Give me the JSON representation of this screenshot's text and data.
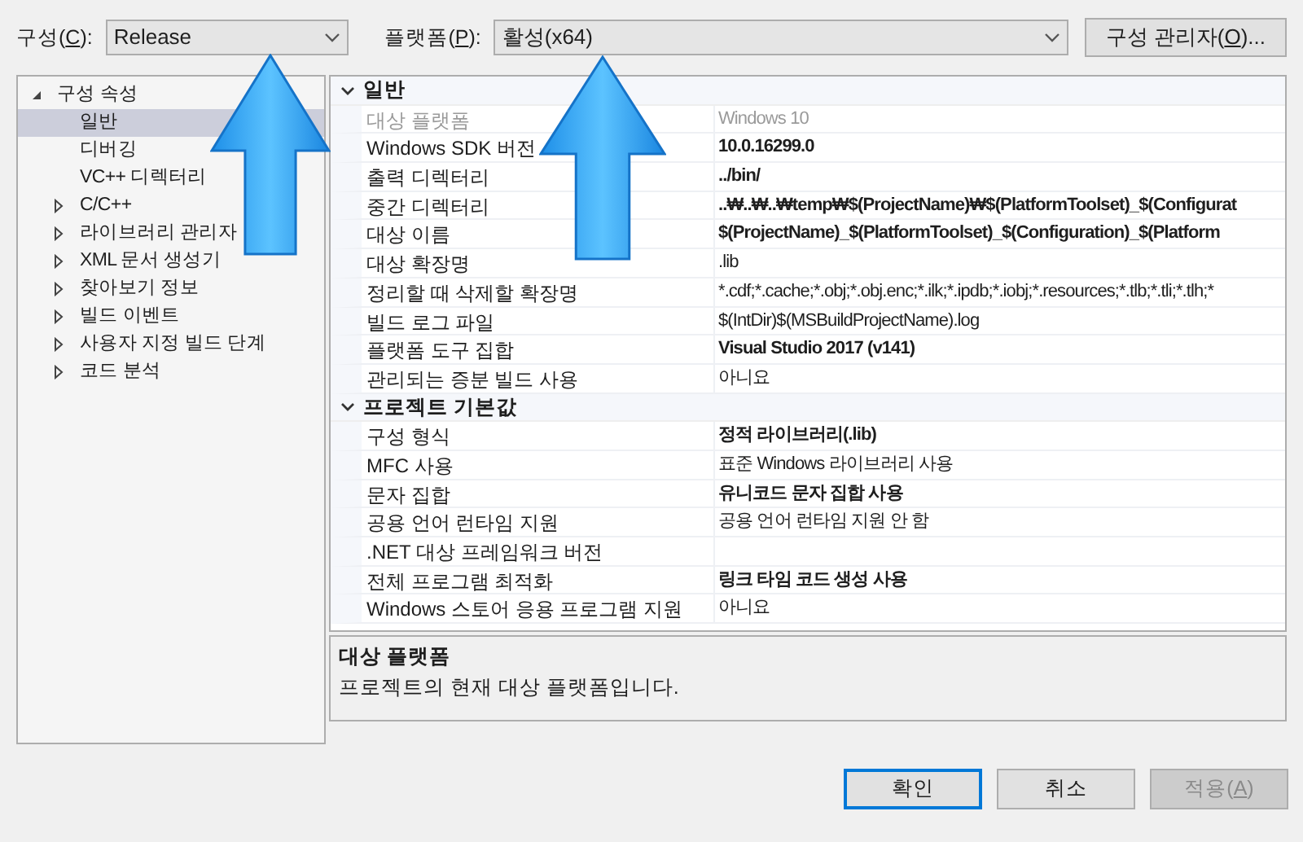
{
  "config": {
    "label": {
      "before": "구성(",
      "key": "C",
      "after": "):"
    },
    "value": "Release"
  },
  "platform": {
    "label": {
      "before": "플랫폼(",
      "key": "P",
      "after": "):"
    },
    "value": "활성(x64)"
  },
  "config_manager": {
    "label": {
      "before": "구성 관리자(",
      "key": "O",
      "after": ")..."
    }
  },
  "tree": [
    {
      "label": "구성 속성",
      "kind": "group",
      "expanded": true,
      "selected": false,
      "children": [
        {
          "label": "일반",
          "kind": "page",
          "selected": true
        },
        {
          "label": "디버깅",
          "kind": "page",
          "selected": false
        },
        {
          "label": "VC++ 디렉터리",
          "kind": "page",
          "selected": false
        },
        {
          "label": "C/C++",
          "kind": "group",
          "expanded": false,
          "selected": false
        },
        {
          "label": "라이브러리 관리자",
          "kind": "group",
          "expanded": false,
          "selected": false
        },
        {
          "label": "XML 문서 생성기",
          "kind": "group",
          "expanded": false,
          "selected": false
        },
        {
          "label": "찾아보기 정보",
          "kind": "group",
          "expanded": false,
          "selected": false
        },
        {
          "label": "빌드 이벤트",
          "kind": "group",
          "expanded": false,
          "selected": false
        },
        {
          "label": "사용자 지정 빌드 단계",
          "kind": "group",
          "expanded": false,
          "selected": false
        },
        {
          "label": "코드 분석",
          "kind": "group",
          "expanded": false,
          "selected": false
        }
      ]
    }
  ],
  "sections": [
    {
      "title": "일반",
      "expanded": true,
      "rows": [
        {
          "name": "대상 플랫폼",
          "value": "Windows 10",
          "bold": false,
          "disabled": true
        },
        {
          "name": "Windows SDK 버전",
          "value": "10.0.16299.0",
          "bold": true,
          "disabled": false
        },
        {
          "name": "출력 디렉터리",
          "value": "../bin/",
          "bold": true,
          "disabled": false
        },
        {
          "name": "중간 디렉터리",
          "value": "..₩..₩..₩temp₩$(ProjectName)₩$(PlatformToolset)_$(Configurat",
          "bold": true,
          "disabled": false
        },
        {
          "name": "대상 이름",
          "value": "$(ProjectName)_$(PlatformToolset)_$(Configuration)_$(Platform",
          "bold": true,
          "disabled": false
        },
        {
          "name": "대상 확장명",
          "value": ".lib",
          "bold": false,
          "disabled": false
        },
        {
          "name": "정리할 때 삭제할 확장명",
          "value": "*.cdf;*.cache;*.obj;*.obj.enc;*.ilk;*.ipdb;*.iobj;*.resources;*.tlb;*.tli;*.tlh;*",
          "bold": false,
          "disabled": false
        },
        {
          "name": "빌드 로그 파일",
          "value": "$(IntDir)$(MSBuildProjectName).log",
          "bold": false,
          "disabled": false
        },
        {
          "name": "플랫폼 도구 집합",
          "value": "Visual Studio 2017 (v141)",
          "bold": true,
          "disabled": false
        },
        {
          "name": "관리되는 증분 빌드 사용",
          "value": "아니요",
          "bold": false,
          "disabled": false
        }
      ]
    },
    {
      "title": "프로젝트 기본값",
      "expanded": true,
      "rows": [
        {
          "name": "구성 형식",
          "value": "정적 라이브러리(.lib)",
          "bold": true,
          "disabled": false
        },
        {
          "name": "MFC 사용",
          "value": "표준 Windows 라이브러리 사용",
          "bold": false,
          "disabled": false
        },
        {
          "name": "문자 집합",
          "value": "유니코드 문자 집합 사용",
          "bold": true,
          "disabled": false
        },
        {
          "name": "공용 언어 런타임 지원",
          "value": "공용 언어 런타임 지원 안 함",
          "bold": false,
          "disabled": false
        },
        {
          "name": ".NET 대상 프레임워크 버전",
          "disabled": false
        },
        {
          "name": "전체 프로그램 최적화",
          "value": "링크 타임 코드 생성 사용",
          "bold": true,
          "disabled": false
        },
        {
          "name": "Windows 스토어 응용 프로그램 지원",
          "value": "아니요",
          "bold": false,
          "disabled": false
        }
      ]
    }
  ],
  "description": {
    "title": "대상 플랫폼",
    "text": "프로젝트의 현재 대상 플랫폼입니다."
  },
  "buttons": [
    {
      "label": {
        "before": "확인"
      },
      "kind": "default",
      "disabled": false
    },
    {
      "label": {
        "before": "취소"
      },
      "kind": "normal",
      "disabled": false
    },
    {
      "label": {
        "before": "적용(",
        "key": "A",
        "after": ")"
      },
      "kind": "normal",
      "disabled": true
    }
  ]
}
